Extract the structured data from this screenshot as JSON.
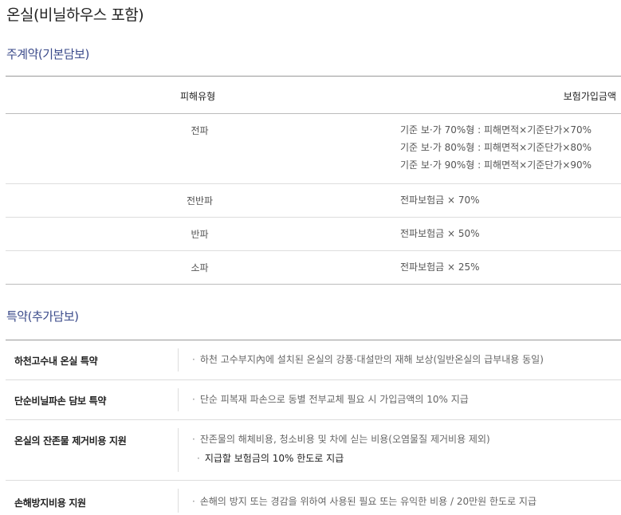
{
  "page_title": "온실(비닐하우스 포함)",
  "main": {
    "title": "주계약(기본담보)",
    "headers": {
      "type": "피해유형",
      "amount": "보험가입금액"
    },
    "rows": [
      {
        "type": "전파",
        "lines": [
          "기준 보·가 70%형 : 피해면적×기준단가×70%",
          "기준 보·가 80%형 : 피해면적×기준단가×80%",
          "기준 보·가 90%형 : 피해면적×기준단가×90%"
        ]
      },
      {
        "type": "전반파",
        "lines": [
          "전파보험금 × 70%"
        ]
      },
      {
        "type": "반파",
        "lines": [
          "전파보험금 × 50%"
        ]
      },
      {
        "type": "소파",
        "lines": [
          "전파보험금 × 25%"
        ]
      }
    ]
  },
  "special": {
    "title": "특약(추가담보)",
    "rows": [
      {
        "name": "하천고수내 온실 특약",
        "desc": "하천 고수부지內에 설치된 온실의 강풍·대설만의 재해 보상(일반온실의 급부내용 동일)"
      },
      {
        "name": "단순비닐파손 담보 특약",
        "desc": "단순 피복재 파손으로 동별 전부교체 필요 시 가입금액의 10% 지급"
      },
      {
        "name": "온실의 잔존물 제거비용 지원",
        "desc": "잔존물의 해체비용, 청소비용 및 차에 싣는 비용(오염물질 제거비용 제외)",
        "sub": "지급할 보험금의 10% 한도로 지급"
      },
      {
        "name": "손해방지비용 지원",
        "desc": "손해의 방지 또는 경감을 위하여 사용된 필요 또는 유익한 비용 / 20만원 한도로 지급"
      }
    ]
  }
}
